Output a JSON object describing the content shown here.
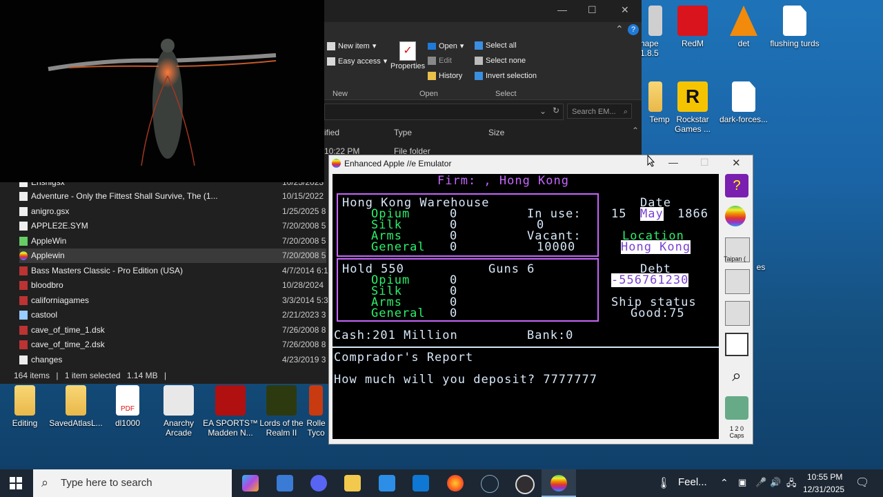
{
  "desktop": {
    "icons_right": [
      {
        "label": "hape\n1.8.5"
      },
      {
        "label": "RedM"
      },
      {
        "label": "det"
      },
      {
        "label": "flushing turds"
      },
      {
        "label": "Temp"
      },
      {
        "label": "Rockstar Games ..."
      },
      {
        "label": "dark-forces..."
      },
      {
        "label": "es"
      }
    ],
    "icons_bottom": [
      {
        "label": "Editing"
      },
      {
        "label": "SavedAtlasL..."
      },
      {
        "label": "dl1000"
      },
      {
        "label": "Anarchy Arcade"
      },
      {
        "label": "EA SPORTS™ Madden N..."
      },
      {
        "label": "Lords of the Realm II"
      },
      {
        "label": "Rolle Tyco"
      }
    ]
  },
  "explorer": {
    "ribbon": {
      "new_item": "New item",
      "easy_access": "Easy access",
      "properties": "Properties",
      "open": "Open",
      "edit": "Edit",
      "history": "History",
      "select_all": "Select all",
      "select_none": "Select none",
      "invert_selection": "Invert selection",
      "group_new": "New",
      "group_open": "Open",
      "group_select": "Select"
    },
    "search_placeholder": "Search EM...",
    "columns": {
      "modified": "ified",
      "type": "Type",
      "size": "Size"
    },
    "partial_row": {
      "date": "10:22 PM",
      "type": "File folder"
    },
    "files": [
      {
        "name": "Enshigsx",
        "date": "10/25/2023"
      },
      {
        "name": "Adventure - Only the Fittest Shall Survive, The (1...",
        "date": "10/15/2022"
      },
      {
        "name": "anigro.gsx",
        "date": "1/25/2025 8"
      },
      {
        "name": "APPLE2E.SYM",
        "date": "7/20/2008 5"
      },
      {
        "name": "AppleWin",
        "date": "7/20/2008 5"
      },
      {
        "name": "Applewin",
        "date": "7/20/2008 5"
      },
      {
        "name": "Bass Masters Classic - Pro Edition (USA)",
        "date": "4/7/2014 6:1"
      },
      {
        "name": "bloodbro",
        "date": "10/28/2024"
      },
      {
        "name": "californiagames",
        "date": "3/3/2014 5:3"
      },
      {
        "name": "castool",
        "date": "2/21/2023 3"
      },
      {
        "name": "cave_of_time_1.dsk",
        "date": "7/26/2008 8"
      },
      {
        "name": "cave_of_time_2.dsk",
        "date": "7/26/2008 8"
      },
      {
        "name": "changes",
        "date": "4/23/2019 3"
      }
    ],
    "status": {
      "count": "164 items",
      "selected": "1 item selected",
      "size": "1.14 MB"
    }
  },
  "emulator": {
    "title": "Enhanced Apple //e Emulator",
    "screen": {
      "firm_line": "Firm: , Hong Kong",
      "warehouse_title": "Hong Kong Warehouse",
      "in_use_label": "In use:",
      "in_use_value": "0",
      "vacant_label": "Vacant:",
      "vacant_value": "10000",
      "goods": [
        "Opium",
        "Silk",
        "Arms",
        "General"
      ],
      "warehouse_qty": [
        "0",
        "0",
        "0",
        "0"
      ],
      "hold_label": "Hold 550",
      "guns_label": "Guns 6",
      "hold_qty": [
        "0",
        "0",
        "0",
        "0"
      ],
      "date_label": "Date",
      "date_day": "15",
      "date_month": "May",
      "date_year": "1866",
      "location_label": "Location",
      "location_value": "Hong Kong",
      "debt_label": "Debt",
      "debt_value": "-556761230",
      "ship_status_label": "Ship status",
      "ship_status_value": "Good:75",
      "cash_line": "Cash:201 Million",
      "bank_line": "Bank:0",
      "report_title": "Comprador's Report",
      "prompt": "How much will you deposit? 7777777"
    },
    "sidebar": {
      "taipan_label": "Taipan (",
      "caps_label": "Caps",
      "caps_top": "1 2 0"
    }
  },
  "taskbar": {
    "search_placeholder": "Type here to search",
    "weather": "Feel...",
    "time": "10:55 PM",
    "date": "12/31/2025"
  }
}
